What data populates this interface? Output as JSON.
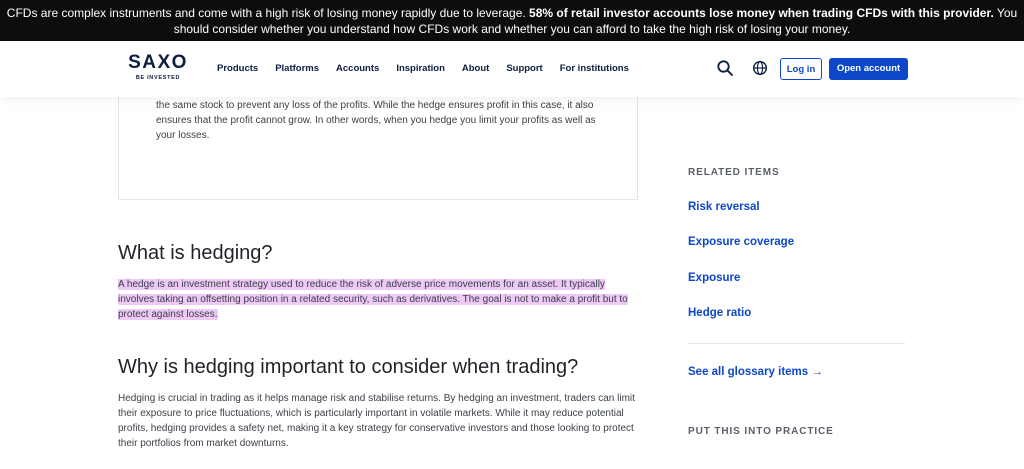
{
  "risk_banner": {
    "part1": "CFDs are complex instruments and come with a high risk of losing money rapidly due to leverage. ",
    "bold": "58% of retail investor accounts lose money when trading CFDs with this provider.",
    "part2": " You should consider whether you understand how CFDs work and whether you can afford to take the high risk of losing your money."
  },
  "header": {
    "logo_word": "SAXO",
    "logo_tag": "BE INVESTED",
    "nav": [
      "Products",
      "Platforms",
      "Accounts",
      "Inspiration",
      "About",
      "Support",
      "For institutions"
    ],
    "login_label": "Log in",
    "open_account_label": "Open account",
    "icons": [
      "search-icon",
      "globe-icon"
    ]
  },
  "article": {
    "card_text": "the same stock to prevent any loss of the profits. While the hedge ensures profit in this case, it also ensures that the profit cannot grow. In other words, when you hedge you limit your profits as well as your losses.",
    "h_what": "What is hedging?",
    "p_what": "A hedge is an investment strategy used to reduce the risk of adverse price movements for an asset. It typically involves taking an offsetting position in a related security, such as derivatives. The goal is not to make a profit but to protect against losses.",
    "h_why": "Why is hedging important to consider when trading?",
    "p_why": "Hedging is crucial in trading as it helps manage risk and stabilise returns. By hedging an investment, traders can limit their exposure to price fluctuations, which is particularly important in volatile markets. While it may reduce potential profits, hedging provides a safety net, making it a key strategy for conservative investors and those looking to protect their portfolios from market downturns."
  },
  "sidebar": {
    "related_label": "RELATED ITEMS",
    "related": [
      "Risk reversal",
      "Exposure coverage",
      "Exposure",
      "Hedge ratio"
    ],
    "see_all": "See all glossary items →",
    "practice_label": "PUT THIS INTO PRACTICE"
  },
  "colors": {
    "accent": "#0d47c9",
    "banner_bg": "#0d0d0d",
    "highlight": "#eec9f5",
    "brand": "#0c1d40"
  }
}
